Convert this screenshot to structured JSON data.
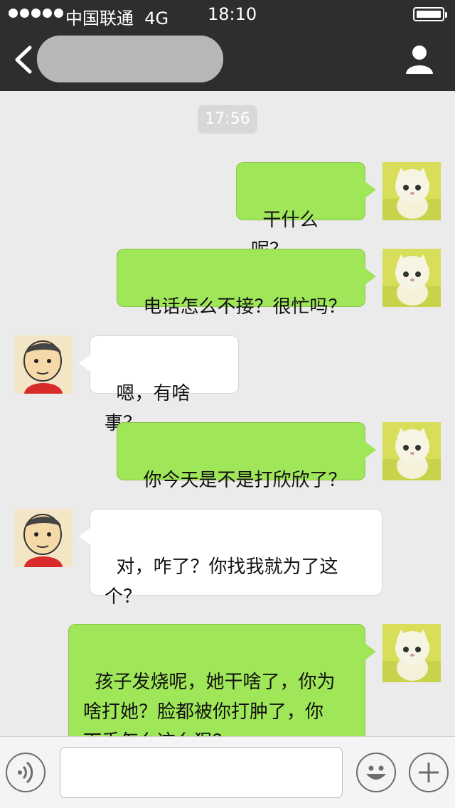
{
  "status_bar": {
    "carrier": "中国联通",
    "network": "4G",
    "time": "18:10"
  },
  "header": {
    "contact_name": "",
    "back_icon": "chevron-left-icon",
    "profile_icon": "person-icon"
  },
  "timestamp": "17:56",
  "messages": [
    {
      "side": "out",
      "sender": "me",
      "text": "干什么呢？"
    },
    {
      "side": "out",
      "sender": "me",
      "text": "电话怎么不接？很忙吗？"
    },
    {
      "side": "in",
      "sender": "contact",
      "text": "嗯，有啥事？"
    },
    {
      "side": "out",
      "sender": "me",
      "text": "你今天是不是打欣欣了？"
    },
    {
      "side": "in",
      "sender": "contact",
      "text": "对，咋了？你找我就为了这\n个？"
    },
    {
      "side": "out",
      "sender": "me",
      "text": "孩子发烧呢，她干啥了，你为\n啥打她？脸都被你打肿了，你\n下手怎么这么狠？"
    }
  ],
  "input_bar": {
    "voice_icon": "voice-icon",
    "text_value": "",
    "emoji_icon": "smiley-icon",
    "plus_icon": "plus-icon"
  },
  "colors": {
    "nav_bg": "#2e2e2e",
    "chat_bg": "#ebebeb",
    "outgoing_bubble": "#9fe658",
    "incoming_bubble": "#ffffff"
  }
}
